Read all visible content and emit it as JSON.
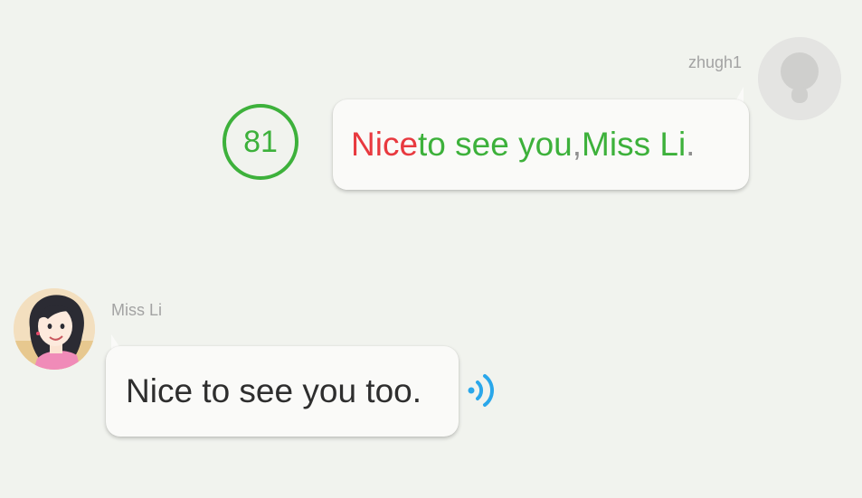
{
  "outgoing": {
    "sender_name": "zhugh1",
    "avatar_icon": "default-user-avatar-icon",
    "score": "81",
    "score_color": "#3db13b",
    "words": [
      {
        "text": "Nice",
        "status": "incorrect",
        "color": "#e8393f"
      },
      {
        "text": " to see you",
        "status": "correct",
        "color": "#3db13b"
      },
      {
        "text": ",",
        "status": "punctuation",
        "color": "#8f8f8f"
      },
      {
        "text": " Miss Li",
        "status": "correct",
        "color": "#3db13b"
      },
      {
        "text": ".",
        "status": "punctuation",
        "color": "#8f8f8f"
      }
    ]
  },
  "incoming": {
    "sender_name": "Miss Li",
    "avatar_icon": "miss-li-avatar-icon",
    "text": "Nice to see you too.",
    "audio_icon": "speaker-wave-icon",
    "audio_color": "#2aa7ea"
  },
  "colors": {
    "background": "#f1f3ee",
    "bubble": "#fafaf8",
    "name_text": "#a3a3a3"
  }
}
